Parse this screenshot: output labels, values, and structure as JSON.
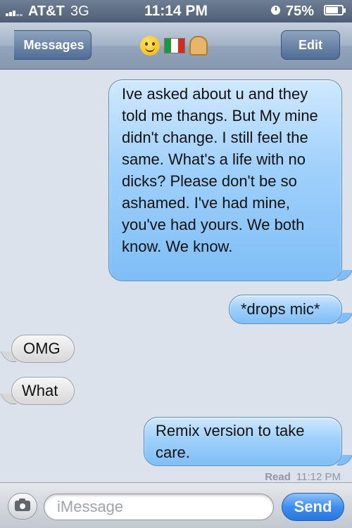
{
  "status_bar": {
    "carrier": "AT&T",
    "network": "3G",
    "time": "11:14 PM",
    "battery": "75%",
    "battery_level": 0.75,
    "icons": [
      "signal-icon",
      "alarm-icon",
      "battery-icon"
    ]
  },
  "nav": {
    "back_label": "Messages",
    "title_emojis": [
      "smiling-face-emoji",
      "italian-flag-emoji",
      "bread-emoji"
    ],
    "edit_label": "Edit"
  },
  "messages": [
    {
      "direction": "sent",
      "text": "Ive asked about u and they told me thangs. But My mine didn't change. I still feel the same. What's a life with no dicks? Please don't be so ashamed. I've had mine, you've had yours. We both know. We know."
    },
    {
      "direction": "sent",
      "text": "*drops mic*"
    },
    {
      "direction": "received",
      "text": "OMG"
    },
    {
      "direction": "received",
      "text": "What"
    },
    {
      "direction": "sent",
      "text": "Remix version to take care."
    }
  ],
  "read_receipt": {
    "label": "Read",
    "time": "11:12 PM"
  },
  "input_bar": {
    "placeholder": "iMessage",
    "value": "",
    "send_label": "Send",
    "camera_icon": "camera-icon"
  },
  "colors": {
    "sent_bubble": "#9fd0fb",
    "received_bubble": "#e6e6e6",
    "send_button": "#3f8ef0",
    "nav_bar": "#a2b2c6"
  }
}
